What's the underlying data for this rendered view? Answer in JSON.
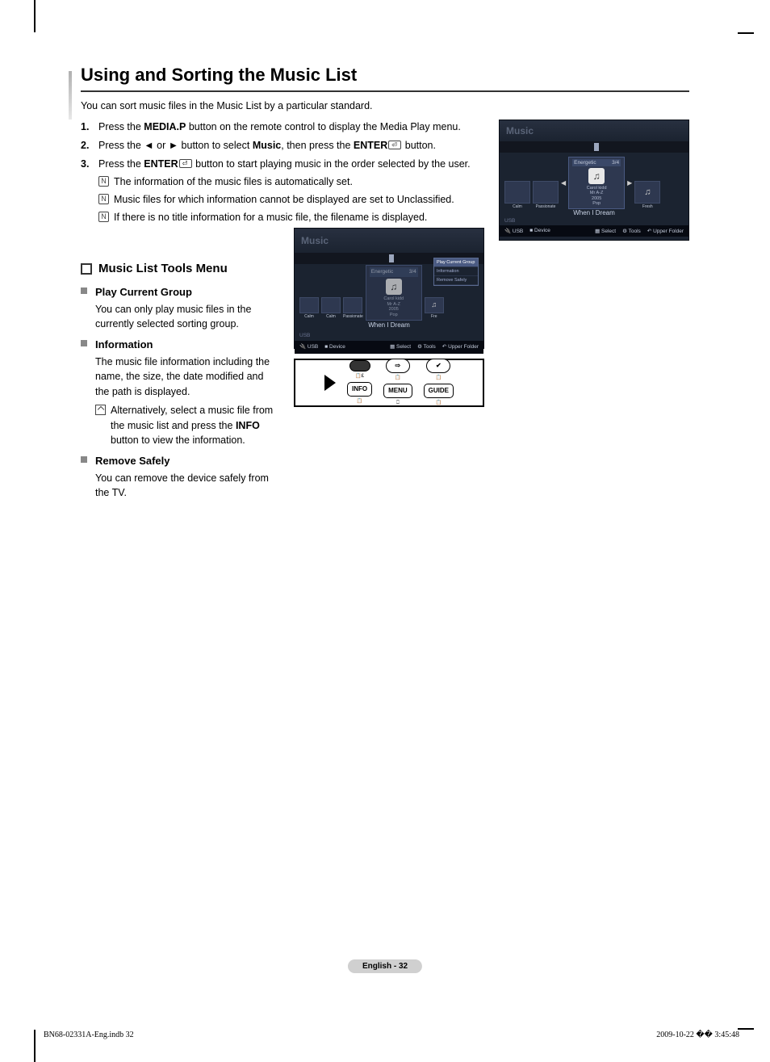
{
  "title": "Using and Sorting the Music List",
  "intro": "You can sort music files in the Music List by a particular standard.",
  "steps": [
    {
      "num": "1.",
      "pre": "Press the ",
      "bold1": "MEDIA.P",
      "post": " button on the remote control to display the Media Play menu."
    },
    {
      "num": "2.",
      "txt_parts": [
        "Press the ◄ or ► button to select ",
        "Music",
        ", then press the ",
        "ENTER",
        " button."
      ]
    },
    {
      "num": "3.",
      "txt_parts": [
        "Press the ",
        "ENTER",
        " button to start playing music in the order selected by the user."
      ]
    }
  ],
  "step_notes": [
    "The information of the music files is automatically set.",
    "Music files for which information cannot be displayed are set to Unclassified.",
    "If there is no title information for a music file, the filename is displayed."
  ],
  "section2": "Music List Tools Menu",
  "subs": [
    {
      "title": "Play Current Group",
      "text": "You can only play music files in the currently selected sorting group."
    },
    {
      "title": "Information",
      "text": "The music file information including the name, the size, the date modified and the path is displayed.",
      "note_parts": [
        "Alternatively, select a music file from the music list and press the ",
        "INFO",
        " button to view the information."
      ]
    },
    {
      "title": "Remove Safely",
      "text": "You can remove the device safely from the TV."
    }
  ],
  "shot1": {
    "hdr": "Music",
    "center_label": "Energetic",
    "center_count": "3/4",
    "lines": [
      "Carol kidd",
      "Mr A-Z",
      "2005",
      "Pop"
    ],
    "songname": "When I Dream",
    "left_lbls": [
      "Calm",
      "Passionate"
    ],
    "right_lbl": "Fresh",
    "usb": "USB",
    "footer": {
      "usb": "USB",
      "device": "Device",
      "select": "Select",
      "tools": "Tools",
      "upper": "Upper Folder"
    }
  },
  "shot2": {
    "hdr": "Music",
    "center_label": "Energetic",
    "center_count": "3/4",
    "lines": [
      "Carol kidd",
      "Mr A-Z",
      "2005",
      "Pop"
    ],
    "songname": "When I Dream",
    "left_lbls": [
      "Calm",
      "Calm",
      "Passionate"
    ],
    "right_lbl": "Fre",
    "usb": "USB",
    "menu": [
      "Play Current Group",
      "Information",
      "Remove Safely"
    ],
    "footer": {
      "usb": "USB",
      "device": "Device",
      "select": "Select",
      "tools": "Tools",
      "upper": "Upper Folder"
    }
  },
  "remote": {
    "info": "INFO",
    "menu": "MENU",
    "guide": "GUIDE"
  },
  "page_footer": "English - 32",
  "print_left": "BN68-02331A-Eng.indb   32",
  "print_right": "2009-10-22   �� 3:45:48"
}
